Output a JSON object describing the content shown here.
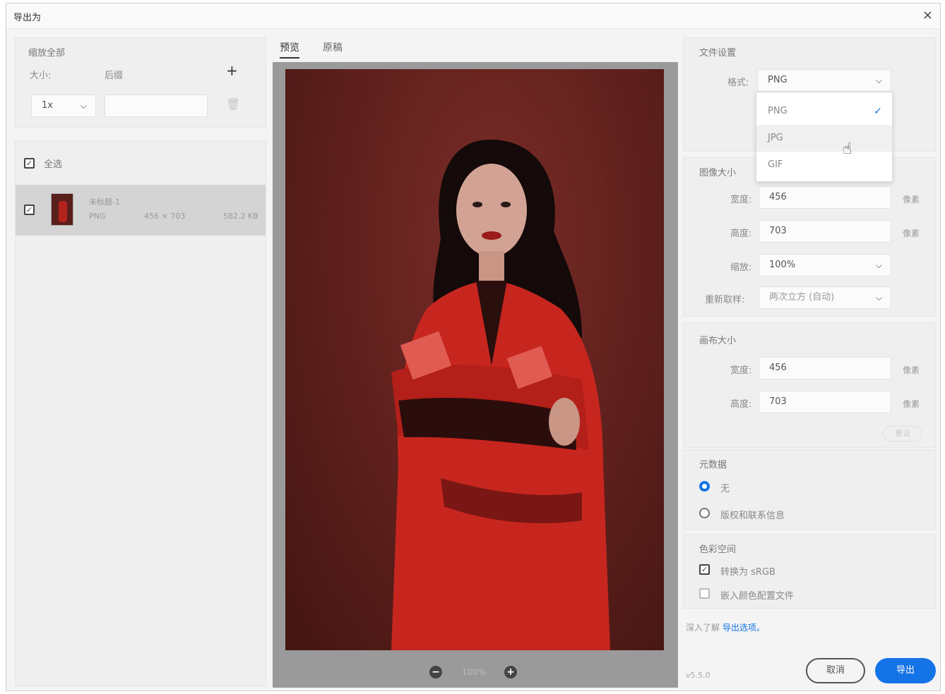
{
  "window": {
    "title": "导出为",
    "close_glyph": "×"
  },
  "left": {
    "scale_section": {
      "title": "缩放全部",
      "size_label": "大小:",
      "suffix_label": "后缀",
      "add_glyph": "+",
      "size_value": "1x",
      "suffix_value": "",
      "delete_glyph": "🗑"
    },
    "all_label": "全选",
    "asset": {
      "name": "未标题-1",
      "format": "PNG",
      "dimensions": "456 × 703",
      "size": "582.2 KB"
    }
  },
  "tabs": [
    {
      "label": "预览"
    },
    {
      "label": "原稿"
    }
  ],
  "preview": {
    "zoom_out_glyph": "−",
    "zoom_level": "100%",
    "zoom_in_glyph": "+"
  },
  "file_settings": {
    "title": "文件设置",
    "format_label": "格式:",
    "format_value": "PNG",
    "options": [
      "PNG",
      "JPG",
      "GIF"
    ],
    "selected_check": "✓"
  },
  "image_size": {
    "title": "图像大小",
    "width_label": "宽度:",
    "width_value": "456",
    "width_unit": "像素",
    "height_label": "高度:",
    "height_value": "703",
    "height_unit": "像素",
    "scale_label": "缩放:",
    "scale_value": "100%",
    "resample_label": "重新取样:",
    "resample_value": "两次立方 (自动)"
  },
  "canvas_size": {
    "title": "画布大小",
    "width_label": "宽度:",
    "width_value": "456",
    "width_unit": "像素",
    "height_label": "高度:",
    "height_value": "703",
    "height_unit": "像素",
    "reset_label": "重设"
  },
  "metadata": {
    "title": "元数据",
    "opt_none": "无",
    "opt_copyright": "版权和联系信息"
  },
  "color_space": {
    "title": "色彩空间",
    "convert_srgb": "转换为 sRGB",
    "embed_profile": "嵌入颜色配置文件"
  },
  "footer": {
    "learn_more_prefix": "深入了解",
    "learn_more_link": "导出选项。",
    "version": "v5.5.0",
    "cancel_label": "取消",
    "export_label": "导出"
  },
  "colors": {
    "accent": "#1473e6",
    "photo_bg": "#5a1e1b",
    "coat": "#c7261f"
  }
}
